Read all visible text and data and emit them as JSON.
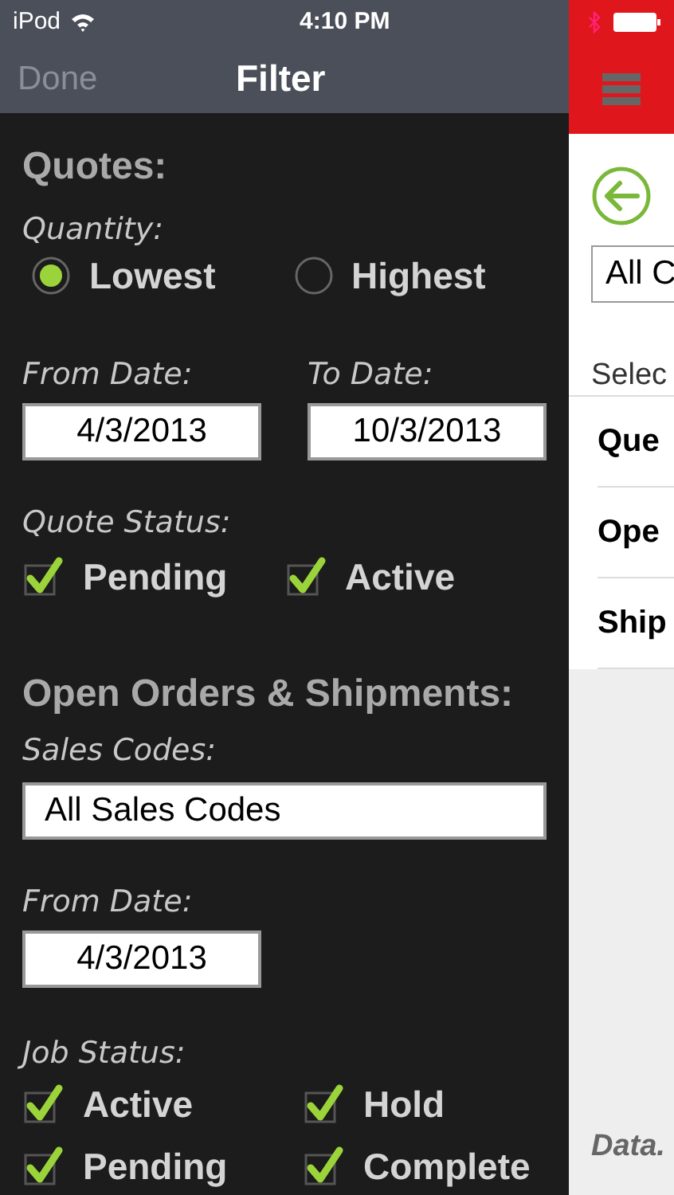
{
  "status_bar": {
    "carrier": "iPod",
    "time": "4:10 PM"
  },
  "nav": {
    "done": {
      "label": "Done",
      "disabled": true
    },
    "title": "Filter"
  },
  "quotes": {
    "heading": "Quotes:",
    "quantity_label": "Quantity:",
    "quantity_options": [
      {
        "label": "Lowest",
        "selected": true
      },
      {
        "label": "Highest",
        "selected": false
      }
    ],
    "from_label": "From Date:",
    "from_value": "4/3/2013",
    "to_label": "To Date:",
    "to_value": "10/3/2013",
    "status_label": "Quote Status:",
    "statuses": [
      {
        "label": "Pending",
        "checked": true
      },
      {
        "label": "Active",
        "checked": true
      }
    ]
  },
  "orders": {
    "heading": "Open Orders & Shipments:",
    "sales_label": "Sales Codes:",
    "sales_value": "All Sales Codes",
    "from_label": "From Date:",
    "from_value": "4/3/2013",
    "job_label": "Job Status:",
    "jobs": [
      {
        "label": "Active",
        "checked": true
      },
      {
        "label": "Hold",
        "checked": true
      },
      {
        "label": "Pending",
        "checked": true
      },
      {
        "label": "Complete",
        "checked": true
      }
    ]
  },
  "side": {
    "select_value": "All C",
    "select_label": "Selec",
    "items": [
      "Que",
      "Ope",
      "Ship"
    ],
    "footer": "Data."
  }
}
